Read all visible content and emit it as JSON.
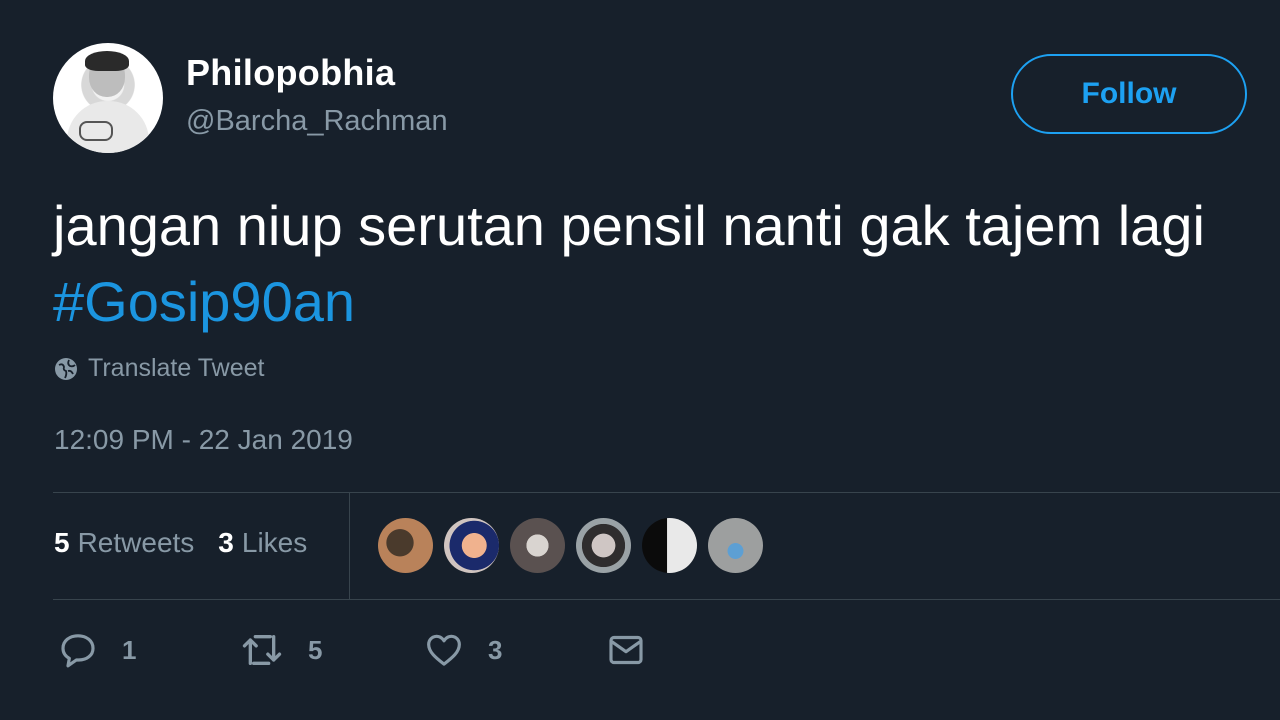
{
  "tweet": {
    "author": {
      "display_name": "Philopobhia",
      "handle": "@Barcha_Rachman"
    },
    "follow_label": "Follow",
    "text_main": "jangan niup serutan pensil nanti gak tajem lagi ",
    "hashtag": "#Gosip90an",
    "translate_label": "Translate Tweet",
    "timestamp": "12:09 PM - 22 Jan 2019",
    "stats": {
      "retweets_count": "5",
      "retweets_label": "Retweets",
      "likes_count": "3",
      "likes_label": "Likes"
    },
    "actions": {
      "reply_count": "1",
      "retweet_count": "5",
      "like_count": "3"
    }
  },
  "colors": {
    "background": "#17202b",
    "accent": "#1da1f2",
    "hashtag": "#1b95e0",
    "secondary_text": "#8899a6",
    "divider": "#38444d"
  },
  "icons": [
    "globe-icon",
    "reply-icon",
    "retweet-icon",
    "heart-icon",
    "mail-icon"
  ]
}
